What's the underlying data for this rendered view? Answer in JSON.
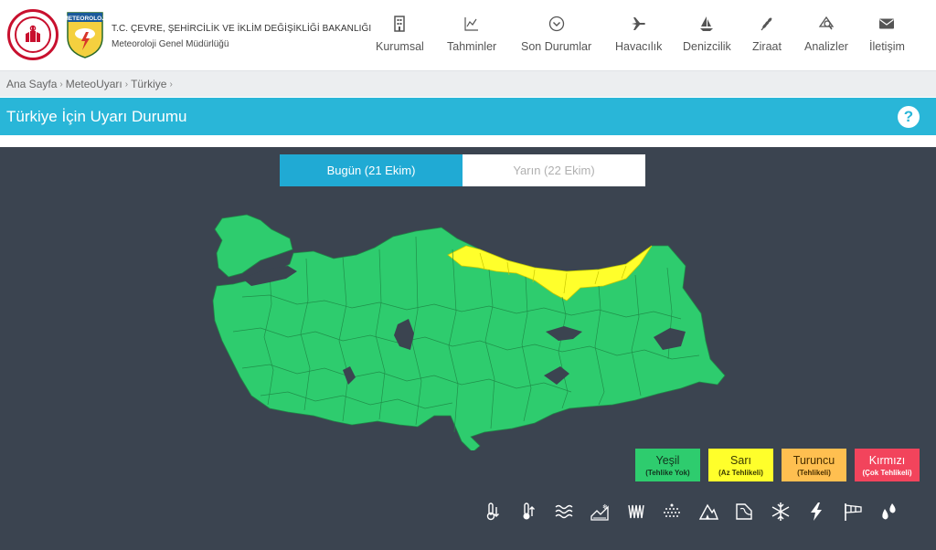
{
  "header": {
    "ministry_name": "T.C. ÇEVRE, ŞEHİRCİLİK VE İKLİM DEĞİŞİKLİĞİ BAKANLIĞI",
    "directorate_name": "Meteoroloji Genel Müdürlüğü",
    "met_logo_text": "METEOROLOJİ",
    "nav": [
      {
        "label": "Kurumsal",
        "icon": "building-icon"
      },
      {
        "label": "Tahminler",
        "icon": "chart-icon"
      },
      {
        "label": "Son Durumlar",
        "icon": "chevron-circle-icon"
      },
      {
        "label": "Havacılık",
        "icon": "plane-icon"
      },
      {
        "label": "Denizcilik",
        "icon": "sailboat-icon"
      },
      {
        "label": "Ziraat",
        "icon": "wheat-icon"
      },
      {
        "label": "Analizler",
        "icon": "analysis-icon"
      },
      {
        "label": "İletişim",
        "icon": "envelope-icon"
      }
    ]
  },
  "breadcrumb": [
    "Ana Sayfa",
    "MeteoUyarı",
    "Türkiye"
  ],
  "page_title": "Türkiye İçin Uyarı Durumu",
  "help": "?",
  "tabs": [
    {
      "label": "Bugün (21 Ekim)",
      "active": true
    },
    {
      "label": "Yarın (22 Ekim)",
      "active": false
    }
  ],
  "map": {
    "colors": {
      "green": "#2ecc6e",
      "yellow": "#ffff2b",
      "water": "#3b4450",
      "borders": "#1f8a47"
    },
    "yellow_region": "Doğu Karadeniz"
  },
  "legend": [
    {
      "label": "Yeşil",
      "sub": "(Tehlike Yok)",
      "color": "#2ecc6e"
    },
    {
      "label": "Sarı",
      "sub": "(Az Tehlikeli)",
      "color": "#ffff2b"
    },
    {
      "label": "Turuncu",
      "sub": "(Tehlikeli)",
      "color": "#ffbf50"
    },
    {
      "label": "Kırmızı",
      "sub": "(Çok Tehlikeli)",
      "color": "#f2445c"
    }
  ],
  "hazard_icons": [
    "cold-icon",
    "heat-icon",
    "fog-icon",
    "snow-melt-icon",
    "avalanche-icon",
    "dust-icon",
    "mountain-icon",
    "rain-icon",
    "snowflake-icon",
    "lightning-icon",
    "wind-icon",
    "drops-icon"
  ]
}
